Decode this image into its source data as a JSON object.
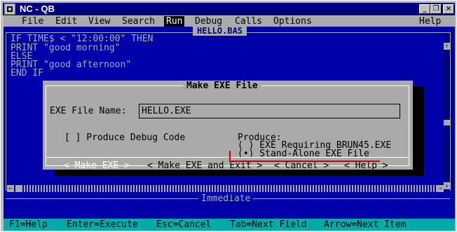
{
  "window": {
    "title": "NC - QB",
    "controls": [
      "_",
      "❐",
      "×"
    ]
  },
  "menu": {
    "items": [
      "File",
      "Edit",
      "View",
      "Search",
      "Run",
      "Debug",
      "Calls",
      "Options"
    ],
    "help": "Help"
  },
  "editor": {
    "filename": "HELLO.BAS",
    "code": [
      "IF TIME$ < \"12:00:00\" THEN",
      "PRINT \"good morning\"",
      "ELSE",
      "PRINT \"good afternoon\"",
      "END IF"
    ],
    "vscroll_up": "↑",
    "vscroll_down": "↓",
    "hscroll_left": "←",
    "hscroll_right": "→"
  },
  "immediate": {
    "title": "Immediate"
  },
  "dialog": {
    "title": "Make EXE File",
    "exe_file_name_label": "EXE File Name:",
    "exe_file_name_value": "HELLO.EXE",
    "debug_checkbox": "[ ] Produce Debug Code",
    "produce_label": "Produce:",
    "option_brun": "( ) EXE Requiring BRUN45.EXE",
    "option_standalone": "(•) Stand-Alone EXE File",
    "buttons": {
      "make_exe": "< Make EXE >",
      "make_exe_exit": "< Make EXE and Exit >",
      "cancel": "< Cancel >",
      "help": "< Help >"
    }
  },
  "statusbar": {
    "items": [
      "F1=Help",
      "Enter=Execute",
      "Esc=Cancel",
      "Tab=Next Field",
      "Arrow=Next Item"
    ]
  },
  "colors": {
    "dos_blue": "#0000aa",
    "dialog_gray": "#aaaaaa",
    "status_cyan": "#00aaaa",
    "annotation_red": "#cc0000"
  }
}
